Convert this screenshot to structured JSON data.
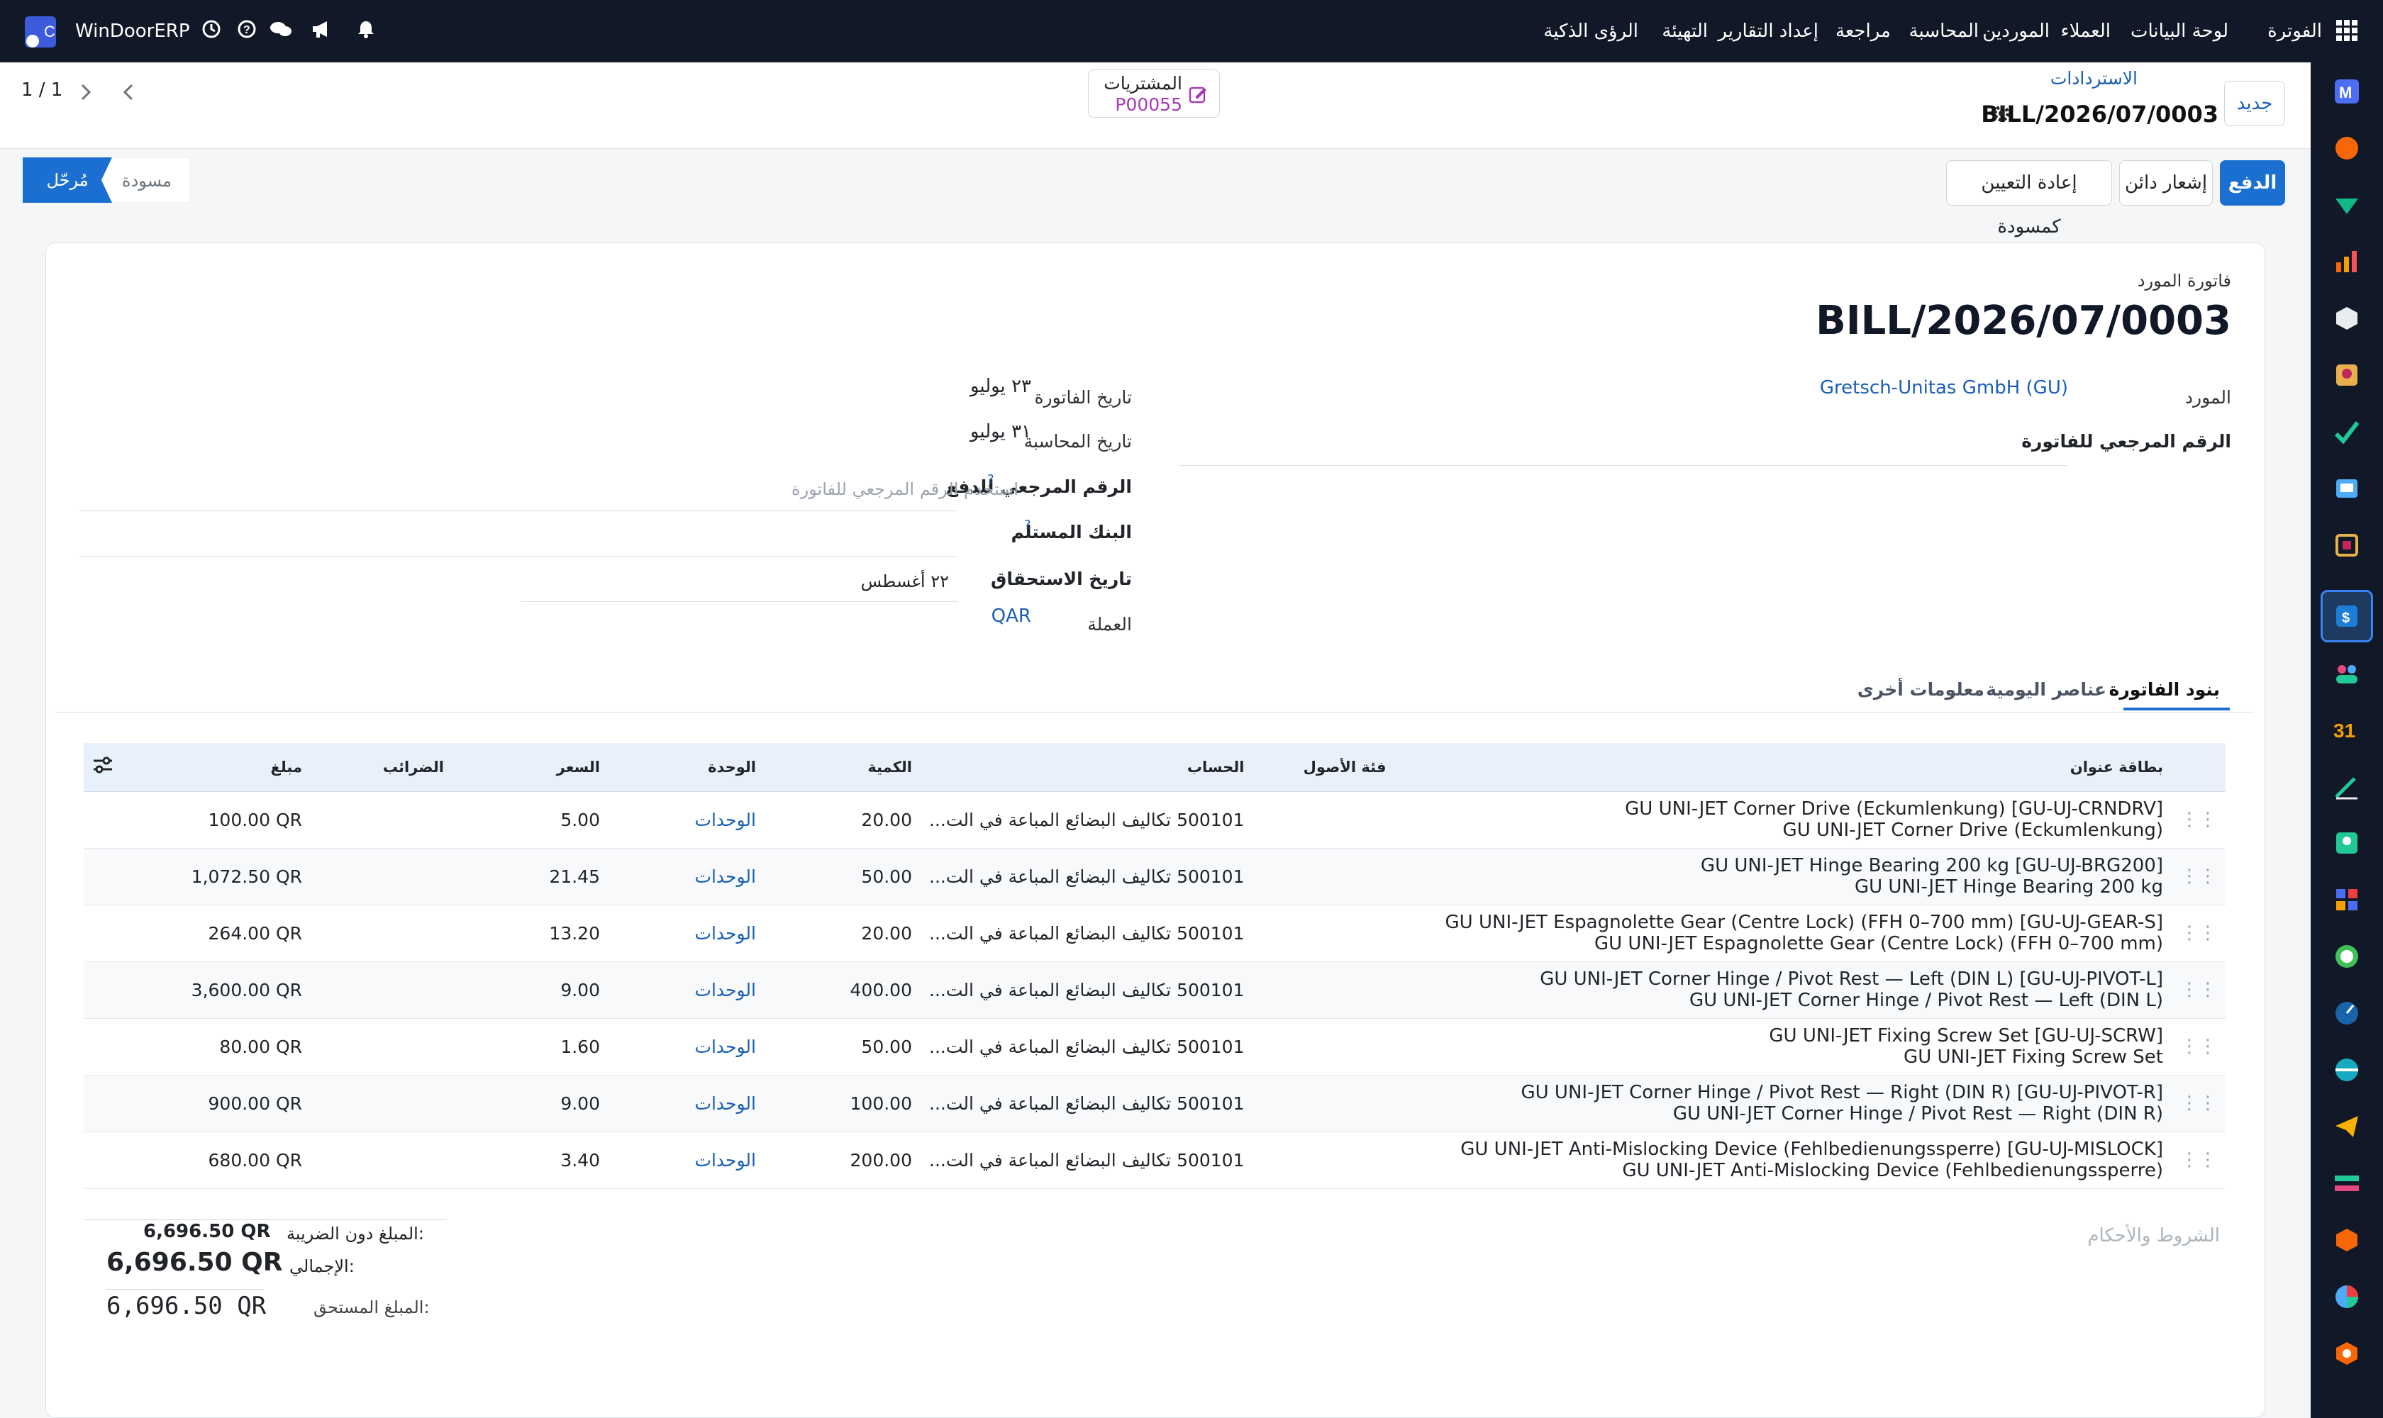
{
  "app": {
    "brand": "WinDoorERP",
    "menu": [
      "الفوترة",
      "لوحة البيانات",
      "العملاء",
      "الموردين",
      "المحاسبة",
      "مراجعة",
      "إعداد التقارير",
      "التهيئة",
      "الرؤى الذكية"
    ]
  },
  "breadcrumb": {
    "parent": "الاستردادات",
    "current": "BILL/2026/07/0003"
  },
  "control": {
    "new_button": "جديد",
    "pager": "1 / 1",
    "purchase_label": "المشتريات",
    "purchase_ref": "P00055"
  },
  "actions": {
    "pay": "الدفع",
    "credit_note": "إشعار دائن",
    "reset_draft": "إعادة التعيين كمسودة"
  },
  "statusbar": {
    "draft": "مسودة",
    "posted": "مُرحّل"
  },
  "form": {
    "type_label": "فاتورة المورد",
    "name": "BILL/2026/07/0003",
    "vendor_label": "المورد",
    "vendor_value": "Gretsch-Unitas GmbH (GU)",
    "bill_ref_label": "الرقم المرجعي للفاتورة",
    "invoice_date_label": "تاريخ الفاتورة",
    "invoice_date_value": "٢٣ يوليو",
    "accounting_date_label": "تاريخ المحاسبة",
    "accounting_date_value": "٣١ يوليو",
    "payment_ref_label": "الرقم المرجعي للدفع",
    "payment_ref_placeholder": "استخدم الرقم المرجعي للفاتورة",
    "bank_label": "البنك المستلم",
    "due_date_label": "تاريخ الاستحقاق",
    "due_date_value": "٢٢ أغسطس",
    "currency_label": "العملة",
    "currency_value": "QAR",
    "help_mark": "?"
  },
  "tabs": [
    "بنود الفاتورة",
    "عناصر اليومية",
    "معلومات أخرى"
  ],
  "lines": {
    "columns": {
      "label": "بطاقة عنوان",
      "asset": "فئة الأصول",
      "account": "الحساب",
      "qty": "الكمية",
      "uom": "الوحدة",
      "price": "السعر",
      "taxes": "الضرائب",
      "amount": "مبلغ"
    },
    "rows": [
      {
        "line1": "GU UNI-JET Corner Drive (Eckumlenkung) [GU-UJ-CRNDRV]",
        "line2": "GU UNI-JET Corner Drive (Eckumlenkung)",
        "account": "500101 تكاليف البضائع المباعة في الت...",
        "qty": "20.00",
        "uom": "الوحدات",
        "price": "5.00",
        "amount": "100.00 QR"
      },
      {
        "line1": "GU UNI-JET Hinge Bearing 200 kg [GU-UJ-BRG200]",
        "line2": "GU UNI-JET Hinge Bearing 200 kg",
        "account": "500101 تكاليف البضائع المباعة في الت...",
        "qty": "50.00",
        "uom": "الوحدات",
        "price": "21.45",
        "amount": "1,072.50 QR"
      },
      {
        "line1": "GU UNI-JET Espagnolette Gear (Centre Lock) (FFH 0–700 mm) [GU-UJ-GEAR-S]",
        "line2": "GU UNI-JET Espagnolette Gear (Centre Lock) (FFH 0–700 mm)",
        "account": "500101 تكاليف البضائع المباعة في الت...",
        "qty": "20.00",
        "uom": "الوحدات",
        "price": "13.20",
        "amount": "264.00 QR"
      },
      {
        "line1": "GU UNI-JET Corner Hinge / Pivot Rest — Left (DIN L) [GU-UJ-PIVOT-L]",
        "line2": "GU UNI-JET Corner Hinge / Pivot Rest — Left (DIN L)",
        "account": "500101 تكاليف البضائع المباعة في الت...",
        "qty": "400.00",
        "uom": "الوحدات",
        "price": "9.00",
        "amount": "3,600.00 QR"
      },
      {
        "line1": "GU UNI-JET Fixing Screw Set [GU-UJ-SCRW]",
        "line2": "GU UNI-JET Fixing Screw Set",
        "account": "500101 تكاليف البضائع المباعة في الت...",
        "qty": "50.00",
        "uom": "الوحدات",
        "price": "1.60",
        "amount": "80.00 QR"
      },
      {
        "line1": "GU UNI-JET Corner Hinge / Pivot Rest — Right (DIN R) [GU-UJ-PIVOT-R]",
        "line2": "GU UNI-JET Corner Hinge / Pivot Rest — Right (DIN R)",
        "account": "500101 تكاليف البضائع المباعة في الت...",
        "qty": "100.00",
        "uom": "الوحدات",
        "price": "9.00",
        "amount": "900.00 QR"
      },
      {
        "line1": "GU UNI-JET Anti-Mislocking Device (Fehlbedienungssperre) [GU-UJ-MISLOCK]",
        "line2": "GU UNI-JET Anti-Mislocking Device (Fehlbedienungssperre)",
        "account": "500101 تكاليف البضائع المباعة في الت...",
        "qty": "200.00",
        "uom": "الوحدات",
        "price": "3.40",
        "amount": "680.00 QR"
      }
    ]
  },
  "terms_placeholder": "الشروط والأحكام",
  "totals": {
    "untaxed_label": "المبلغ دون الضريبة:",
    "untaxed_value": "6,696.50 QR",
    "total_label": "الإجمالي:",
    "total_value": "6,696.50 QR",
    "due_label": "المبلغ المستحق:",
    "due_value": "6,696.50 QR"
  },
  "colors": {
    "navbar": "#111827",
    "primary": "#1a6fd1",
    "link": "#1a5fb4",
    "purchase_ref": "#a43bb5"
  }
}
